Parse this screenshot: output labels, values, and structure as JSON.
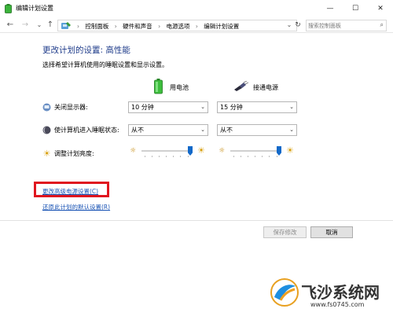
{
  "window": {
    "title": "编辑计划设置",
    "minimize": "—",
    "maximize": "☐",
    "close": "✕"
  },
  "nav": {
    "back": "←",
    "forward": "→",
    "history": "⌄",
    "up": "↑",
    "breadcrumbs": [
      "控制面板",
      "硬件和声音",
      "电源选项",
      "编辑计划设置"
    ],
    "breadcrumb_separator": "›",
    "address_dropdown": "⌄",
    "refresh": "↻",
    "search_placeholder": "搜索控制面板",
    "search_icon": "⌕"
  },
  "main": {
    "heading": "更改计划的设置: 高性能",
    "subheading": "选择希望计算机使用的睡眠设置和显示设置。",
    "columns": {
      "battery": "用电池",
      "plugged_in": "接通电源"
    },
    "rows": {
      "display": {
        "label": "关闭显示器:",
        "battery_value": "10 分钟",
        "plugged_value": "15 分钟"
      },
      "sleep": {
        "label": "使计算机进入睡眠状态:",
        "battery_value": "从不",
        "plugged_value": "从不"
      },
      "brightness": {
        "label": "调整计划亮度:",
        "battery_level": 1.0,
        "plugged_level": 1.0
      }
    },
    "links": {
      "advanced": "更改高级电源设置(C)",
      "restore": "还原此计划的默认设置(R)"
    },
    "buttons": {
      "save": "保存修改",
      "cancel": "取消"
    },
    "dropdown_arrow": "⌄"
  },
  "watermark": {
    "name": "飞沙系统网",
    "url": "www.fs0745.com"
  },
  "colors": {
    "heading": "#1e3b8a",
    "link": "#1a54b5",
    "highlight": "#e0161f",
    "slider_thumb": "#1269c9"
  }
}
